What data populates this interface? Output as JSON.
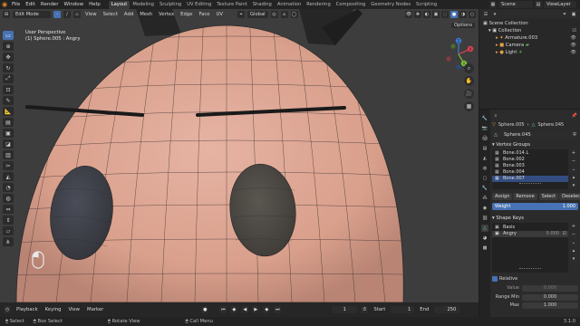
{
  "topbar": {
    "menus": [
      "File",
      "Edit",
      "Render",
      "Window",
      "Help"
    ],
    "workspaces": [
      "Layout",
      "Modeling",
      "Sculpting",
      "UV Editing",
      "Texture Paint",
      "Shading",
      "Animation",
      "Rendering",
      "Compositing",
      "Geometry Nodes",
      "Scripting"
    ],
    "active_workspace": "Layout",
    "scene": "Scene",
    "view_layer": "ViewLayer"
  },
  "header3d": {
    "mode": "Edit Mode",
    "menus": [
      "View",
      "Select",
      "Add",
      "Mesh",
      "Vertex",
      "Edge",
      "Face",
      "UV"
    ],
    "transform_orientation": "Global",
    "options": "Options"
  },
  "viewport": {
    "line1": "User Perspective",
    "line2": "(1) Sphere.005 : Angry",
    "gizmo": {
      "x": "X",
      "y": "Y",
      "z": "Z"
    }
  },
  "timeline": {
    "menus": [
      "Playback",
      "Keying",
      "View",
      "Marker"
    ],
    "current_frame": "1",
    "start_label": "Start",
    "start": "1",
    "end_label": "End",
    "end": "250"
  },
  "status": {
    "items": [
      "Select",
      "Box Select",
      "Rotate View",
      "Call Menu"
    ],
    "version": "3.1.0"
  },
  "outliner": {
    "title": "Scene Collection",
    "items": [
      {
        "label": "Collection",
        "indent": 1
      },
      {
        "label": "Armature.003",
        "indent": 2
      },
      {
        "label": "Camera",
        "indent": 2
      },
      {
        "label": "Light",
        "indent": 2
      }
    ]
  },
  "properties": {
    "object_name": "Sphere.005",
    "data_name": "Sphere.045",
    "mesh_name": "Sphere.045",
    "vertex_groups_title": "Vertex Groups",
    "vertex_groups": [
      "Bone.014.L",
      "Bone.002",
      "Bone.003",
      "Bone.004",
      "Bone.007"
    ],
    "selected_vertex_group": "Bone.007",
    "buttons": [
      "Assign",
      "Remove",
      "Select",
      "Deselect"
    ],
    "weight_label": "Weight",
    "weight_value": "1.000",
    "shape_keys_title": "Shape Keys",
    "shape_keys": [
      "Basis",
      "Angry"
    ],
    "selected_shape_key": "Angry",
    "angry_value": "0.000",
    "relative_label": "Relative",
    "value_label": "Value",
    "value": "0.000",
    "range_min_label": "Range Min",
    "range_min": "0.000",
    "max_label": "Max",
    "max": "1.000"
  },
  "colors": {
    "accent": "#4772b3",
    "viewport_bg": "#3d3d3d",
    "mesh_skin": "#e0a896",
    "eye": "#3f3f45"
  }
}
